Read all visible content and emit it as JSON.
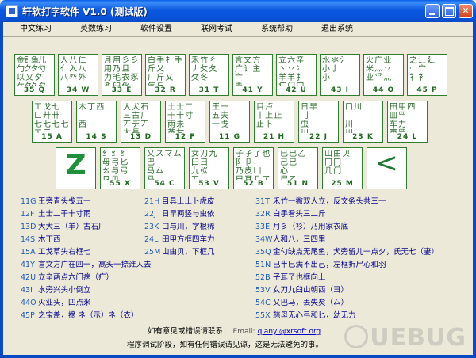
{
  "window": {
    "title": "轩软打字软件 V1.0  (测试版)"
  },
  "menu": [
    "中文练习",
    "英数练习",
    "软件设置",
    "联网考试",
    "系统帮助",
    "退出系统"
  ],
  "keyboard": {
    "row1": [
      {
        "label": "35 Q",
        "glyphs": "金钅鱼儿\n勹クタ勺\n以 又 夕\nケタ久夕"
      },
      {
        "label": "34 W",
        "glyphs": "人 八 仁\n亻 入 八\n八 癶 外"
      },
      {
        "label": "33 E",
        "glyphs": "月 用 彡 彡\n用 乃 且\n力 毛 衣 豕\n豸 臼 化"
      },
      {
        "label": "32 R",
        "glyphs": "白 手 扌 手\n斤 乂 \n厂 斤 乂 \n气 丘"
      },
      {
        "label": "31 T",
        "glyphs": "禾 竹 彳 \n丿 攵 夂 \n攵 冬"
      },
      {
        "label": "41 Y",
        "glyphs": "言 文 方\n广 讠 主\n亠 \n圭"
      },
      {
        "label": "42 U",
        "glyphs": "立 六 辛\n丶 丷 冫\n羊 羊 扌\n疒 门 冂"
      },
      {
        "label": "43 I",
        "glyphs": "水 氺 氵\n小 亅 \n小"
      },
      {
        "label": "44 O",
        "glyphs": "火 广 业\n米 灬 丷\n业 爫 灬"
      },
      {
        "label": "45 P",
        "glyphs": "之 辶 廴\n冖 宀 \n礻 衤"
      }
    ],
    "row2": [
      {
        "label": "15 A",
        "glyphs": "工 戈 七\n匚 廾 卄\n七 七 七 七\n工 匚"
      },
      {
        "label": "14 S",
        "glyphs": "木 丁 西\n\n西"
      },
      {
        "label": "13 D",
        "glyphs": "大 犬 石\n三 古 厂\n丆 デ 丆 \n尢 長"
      },
      {
        "label": "12 F",
        "glyphs": "土 士 二\n干 十 寸\n雨 未 \n革 甘"
      },
      {
        "label": "11 G",
        "glyphs": "王 一 \n五 夫 \n一 戋"
      },
      {
        "label": "21 H",
        "glyphs": "目 卢 \n丨 上 止\n止 卜"
      },
      {
        "label": "22 J",
        "glyphs": "日 早 \n刂 \n虫 \n川"
      },
      {
        "label": "23 K",
        "glyphs": "口 川 \n\n川 \n川"
      },
      {
        "label": "24 L",
        "glyphs": "田 甲 四\n皿 罒 \n车 力 \n車 罒"
      }
    ],
    "row3": [
      {
        "label": "",
        "big": "Z"
      },
      {
        "label": "55 X",
        "glyphs": "纟 纟 纟\n母 弓 匕\n幺 与 弓\n㔾 贝"
      },
      {
        "label": "54 C",
        "glyphs": "又 ス マ ム\n巴 \n马 厶 \n马"
      },
      {
        "label": "53 V",
        "glyphs": "女 刀 九\n臼 彐 \n九 巛 \n刀"
      },
      {
        "label": "52 B",
        "glyphs": "子 孑 了 也\n阝 卩 \n乃 皮 凵\n巳 耳 卩 了"
      },
      {
        "label": "51 N",
        "glyphs": "已 巳 乙 \n己 巳 \n心 \n尸 乙"
      },
      {
        "label": "25 M",
        "glyphs": "山 由 贝\n冂 冂 \n几 门"
      },
      {
        "label": "",
        "big": "<"
      }
    ]
  },
  "reference_list": [
    {
      "code": "11G",
      "desc": "王旁青头戋五一"
    },
    {
      "code": "12F",
      "desc": "土士二干十寸雨"
    },
    {
      "code": "13D",
      "desc": "大犬三（羊）古石厂"
    },
    {
      "code": "14S",
      "desc": "木丁西"
    },
    {
      "code": "15A",
      "desc": "工戈草头右框七"
    },
    {
      "code": "21H",
      "desc": "目具上止卜虎皮"
    },
    {
      "code": "22J",
      "desc": "日早两竖与虫依"
    },
    {
      "code": "23K",
      "desc": "口与川，字根稀"
    },
    {
      "code": "24L",
      "desc": "田甲方框四车力"
    },
    {
      "code": "25M",
      "desc": "山由贝，下框几"
    },
    {
      "code": "31T",
      "desc": "禾竹一撇双人立，反文条头共三一"
    },
    {
      "code": "32R",
      "desc": "白手看头三二斤"
    },
    {
      "code": "33E",
      "desc": "月彡（衫）乃用家衣底"
    },
    {
      "code": "34W",
      "desc": "人和八，三四里"
    },
    {
      "code": "35Q",
      "desc": "金勺缺点无尾鱼，犬旁留儿一点夕，氏无七（妻）"
    },
    {
      "code": "41Y",
      "desc": "言文方广在四一，高头一捺谁人去"
    },
    {
      "code": "42U",
      "desc": "立辛两点六门病（疒）"
    },
    {
      "code": "43I",
      "desc": "水旁兴头小倒立"
    },
    {
      "code": "44O",
      "desc": "火业头，四点米"
    },
    {
      "code": "45P",
      "desc": "之宝盖，摘 ネ（示）ネ（衣）"
    },
    {
      "code": "51N",
      "desc": "已半巳满不出己，左框折尸心和羽"
    },
    {
      "code": "52B",
      "desc": "子耳了也框向上"
    },
    {
      "code": "53V",
      "desc": "女刀九臼山朝西（彐）"
    },
    {
      "code": "54C",
      "desc": "又巴马，丢失矣（厶）"
    },
    {
      "code": "55X",
      "desc": "慈母无心弓和匕，幼无力"
    }
  ],
  "footer": {
    "contact_text": "如有意见或错误请联系：",
    "email_label": "Email:",
    "email": "qianyl@xrsoft.org",
    "notice": "程序调试阶段，如有任何错误请见谅，这是无法避免的事。"
  },
  "watermark": "UEBUG"
}
